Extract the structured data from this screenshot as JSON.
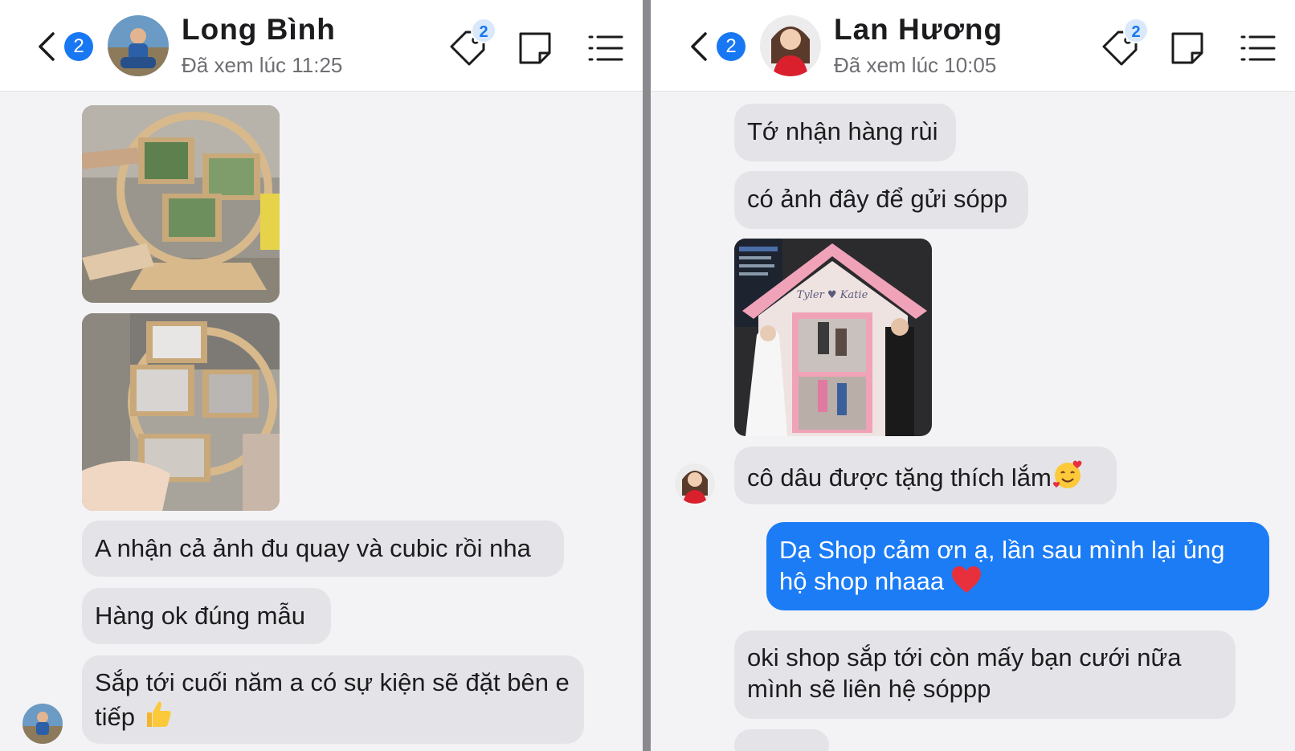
{
  "left": {
    "unread_count": "2",
    "contact_name": "Long Bình",
    "seen_status": "Đã xem lúc 11:25",
    "tag_badge": "2",
    "messages": [
      "A nhận cả ảnh đu quay và cubic rồi nha",
      "Hàng ok đúng mẫu",
      "Sắp tới cuối năm a có sự kiện sẽ đặt bên e tiếp"
    ]
  },
  "right": {
    "unread_count": "2",
    "contact_name": "Lan Hương",
    "seen_status": "Đã xem lúc 10:05",
    "tag_badge": "2",
    "messages": [
      "Tớ nhận hàng rùi",
      "có ảnh đây để gửi sópp",
      "cô dâu được tặng thích lắm",
      "Dạ Shop cảm ơn ạ, lần sau mình lại ủng hộ shop nhaaa",
      "oki shop sắp tới còn mấy bạn cưới nữa mình sẽ liên hệ sóppp"
    ]
  },
  "colors": {
    "accent": "#1877f2",
    "outgoing_bubble": "#1b7cf5",
    "incoming_bubble": "#e4e4e8",
    "header_bg": "#ffffff",
    "chat_bg": "#f3f3f5"
  },
  "icons": [
    "back-chevron-icon",
    "tag-icon",
    "note-icon",
    "list-menu-icon",
    "thumbs-up-emoji",
    "smiling-face-with-hearts-emoji",
    "red-heart-emoji"
  ]
}
